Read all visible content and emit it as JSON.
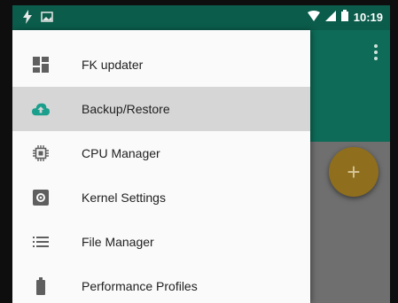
{
  "status_bar": {
    "time": "10:19",
    "icons": [
      "flash-icon",
      "image-icon",
      "wifi-icon",
      "signal-icon",
      "battery-icon"
    ]
  },
  "drawer": {
    "items": [
      {
        "label": "FK updater",
        "icon": "dashboard-icon",
        "active": false
      },
      {
        "label": "Backup/Restore",
        "icon": "cloud-upload-icon",
        "active": true
      },
      {
        "label": "CPU Manager",
        "icon": "cpu-chip-icon",
        "active": false
      },
      {
        "label": "Kernel Settings",
        "icon": "settings-box-icon",
        "active": false
      },
      {
        "label": "File Manager",
        "icon": "list-icon",
        "active": false
      },
      {
        "label": "Performance Profiles",
        "icon": "battery-icon",
        "active": false
      }
    ]
  },
  "fab": {
    "label": "+"
  },
  "colors": {
    "app_bar": "#0d6b57",
    "status_bar": "#0b5c4b",
    "fab": "#8f6f1d",
    "active_item": "#d6d6d6",
    "icon_teal": "#1a9f8c"
  }
}
